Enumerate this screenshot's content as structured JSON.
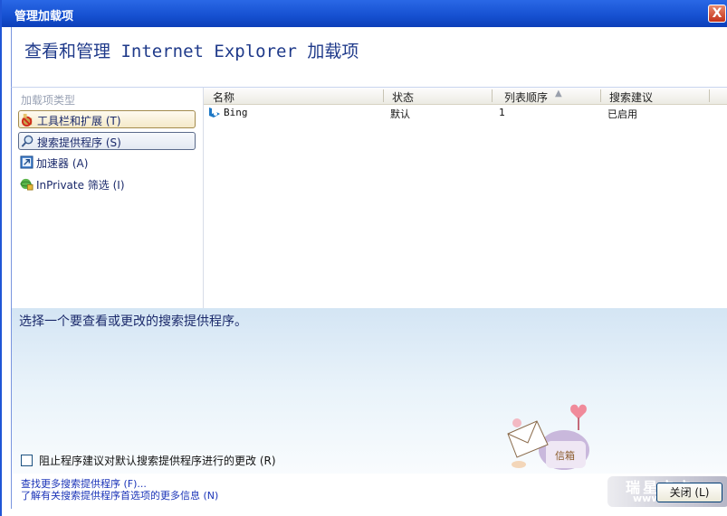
{
  "window": {
    "title": "管理加载项",
    "close_glyph": "X"
  },
  "header": {
    "title": "查看和管理 Internet Explorer 加载项"
  },
  "sidebar": {
    "title": "加载项类型",
    "items": [
      {
        "label": "工具栏和扩展 (T)",
        "icon": "toolbar-extensions-icon"
      },
      {
        "label": "搜索提供程序 (S)",
        "icon": "search-icon"
      },
      {
        "label": "加速器 (A)",
        "icon": "accelerator-icon"
      },
      {
        "label": "InPrivate 筛选 (I)",
        "icon": "inprivate-icon"
      }
    ]
  },
  "table": {
    "columns": [
      "名称",
      "状态",
      "列表顺序",
      "搜索建议"
    ],
    "sort_indicator": "▲",
    "rows": [
      {
        "name": "Bing",
        "status": "默认",
        "order": "1",
        "suggestions": "已启用",
        "icon": "bing-icon"
      }
    ]
  },
  "details": {
    "description": "选择一个要查看或更改的搜索提供程序。",
    "checkbox_label": "阻止程序建议对默认搜索提供程序进行的更改 (R)",
    "checkbox_checked": false
  },
  "footer": {
    "link1": "查找更多搜索提供程序 (F)...",
    "link2": "了解有关搜索提供程序首选项的更多信息 (N)",
    "close_label": "关闭 (L)"
  },
  "watermark": {
    "text": "瑞星卡卡",
    "url": "www.kaka.com"
  },
  "decoration": {
    "mailbox_label": "信箱"
  },
  "colors": {
    "titlebar": "#1550d0",
    "accent_text": "#1f3a8a",
    "link": "#1b34b8"
  }
}
